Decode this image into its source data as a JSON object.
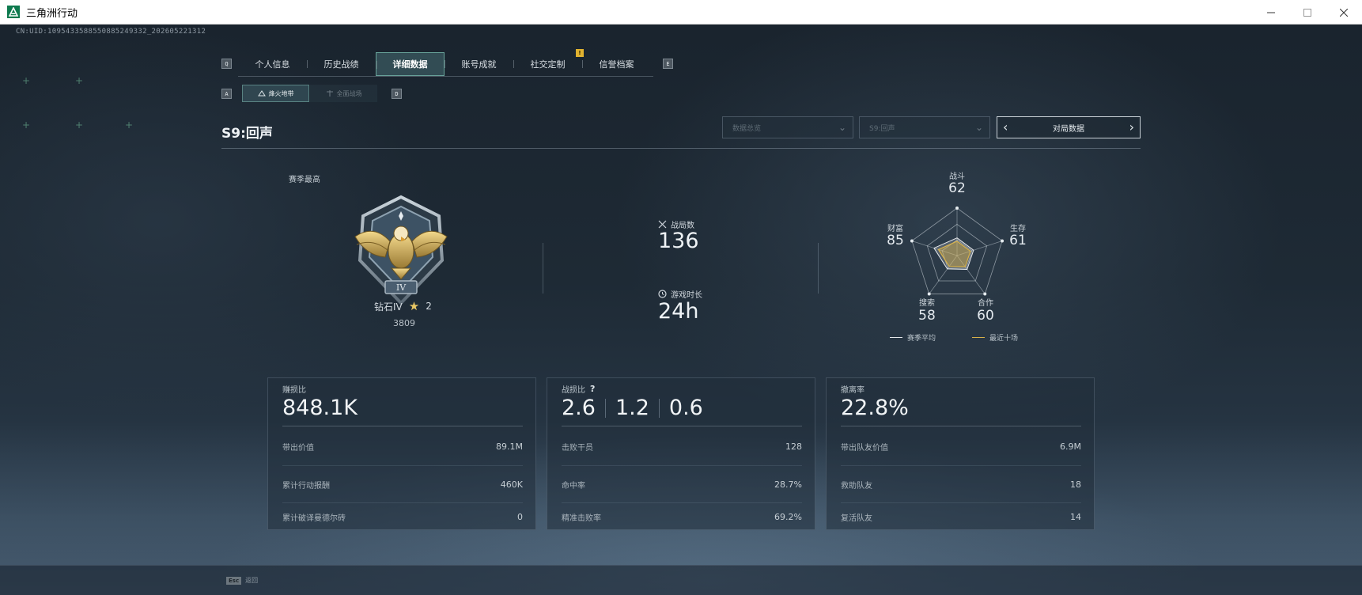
{
  "window": {
    "title": "三角洲行动",
    "min_icon": "minimize-icon",
    "max_icon": "maximize-icon",
    "close_icon": "close-icon"
  },
  "uid": "CN:UID:1095433588550885249332_202605221312",
  "nav": {
    "prev_key": "Q",
    "next_key": "E",
    "tabs": [
      {
        "label": "个人信息"
      },
      {
        "label": "历史战绩"
      },
      {
        "label": "详细数据",
        "active": true
      },
      {
        "label": "账号成就"
      },
      {
        "label": "社交定制",
        "badge": "!"
      },
      {
        "label": "信誉档案"
      }
    ]
  },
  "subnav": {
    "prev_key": "A",
    "next_key": "D",
    "tabs": [
      {
        "label": "烽火地带",
        "active": true
      },
      {
        "label": "全面战场",
        "active": false
      }
    ]
  },
  "season": {
    "title": "S9:回声",
    "filter1": "数据总览",
    "filter2": "S9:回声",
    "pager_label": "对局数据"
  },
  "rank": {
    "label": "赛季最高",
    "name": "钻石IV",
    "stars": "2",
    "score": "3809",
    "emblem_icon": "eagle-rank-emblem-icon"
  },
  "summary": {
    "matches_label": "战局数",
    "matches_value": "136",
    "playtime_label": "游戏时长",
    "playtime_value": "24h"
  },
  "radar": {
    "axes": [
      {
        "label": "战斗",
        "value": "62"
      },
      {
        "label": "生存",
        "value": "61"
      },
      {
        "label": "合作",
        "value": "60"
      },
      {
        "label": "搜索",
        "value": "58"
      },
      {
        "label": "财富",
        "value": "85"
      }
    ],
    "legend_avg": "赛季平均",
    "legend_recent": "最近十场",
    "avg_color": "#e6e9ec",
    "recent_color": "#d8b24a"
  },
  "panels": {
    "profit": {
      "label": "赚损比",
      "value": "848.1K",
      "rows": [
        {
          "label": "带出价值",
          "value": "89.1M"
        },
        {
          "label": "累计行动报酬",
          "value": "460K"
        },
        {
          "label": "累计破译曼德尔砖",
          "value": "0"
        }
      ]
    },
    "kd": {
      "label": "战损比",
      "help": "?",
      "values": [
        "2.6",
        "1.2",
        "0.6"
      ],
      "rows": [
        {
          "label": "击败干员",
          "value": "128"
        },
        {
          "label": "命中率",
          "value": "28.7%"
        },
        {
          "label": "精准击败率",
          "value": "69.2%"
        }
      ]
    },
    "extract": {
      "label": "撤离率",
      "value": "22.8%",
      "rows": [
        {
          "label": "带出队友价值",
          "value": "6.9M"
        },
        {
          "label": "救助队友",
          "value": "18"
        },
        {
          "label": "复活队友",
          "value": "14"
        }
      ]
    }
  },
  "footer": {
    "esc_key": "Esc",
    "esc_label": "返回"
  }
}
